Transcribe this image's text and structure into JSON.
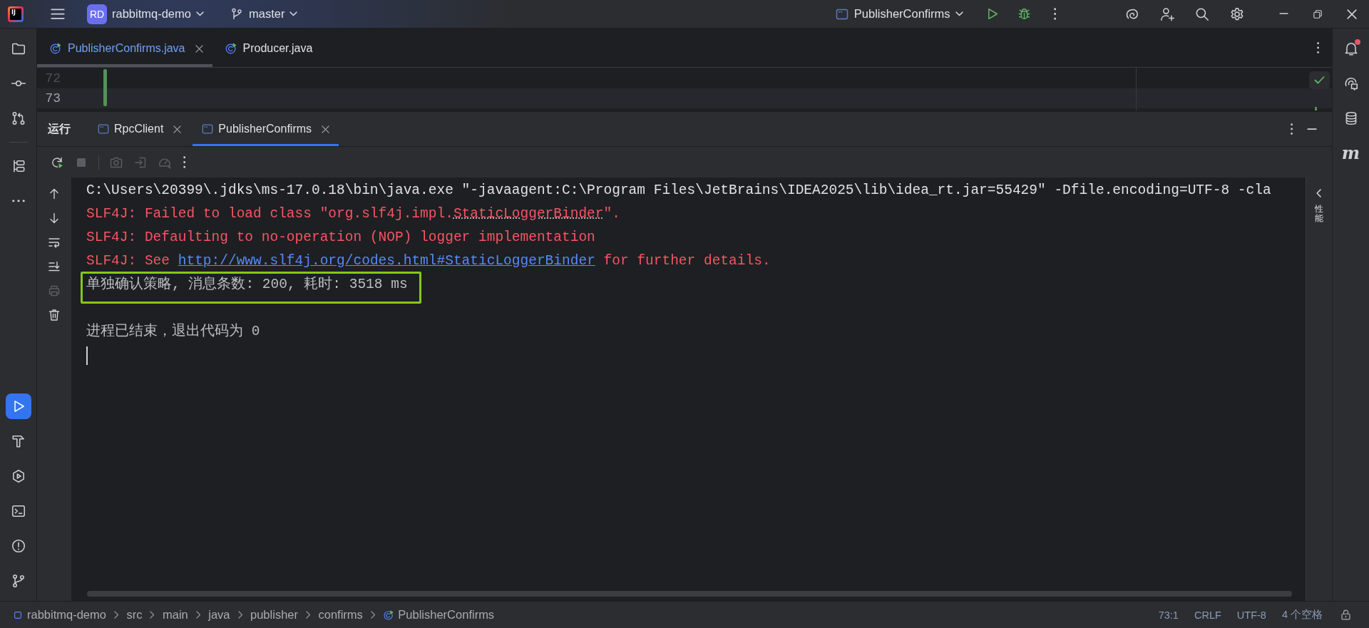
{
  "title_bar": {
    "logo": "IJ",
    "project": {
      "initials": "RD",
      "name": "rabbitmq-demo"
    },
    "branch": "master",
    "run_configuration": "PublisherConfirms"
  },
  "left_toolbar": {
    "top_groups": [
      [
        {
          "kind": "project",
          "selected": false
        },
        {
          "kind": "commit",
          "selected": false
        },
        {
          "kind": "pull_requests",
          "selected": false
        }
      ],
      [
        {
          "kind": "structure",
          "selected": false
        },
        {
          "kind": "more",
          "selected": false
        }
      ]
    ],
    "bottom": [
      {
        "kind": "run",
        "selected": true
      },
      {
        "kind": "build",
        "selected": false
      },
      {
        "kind": "services",
        "selected": false
      },
      {
        "kind": "terminal",
        "selected": false
      },
      {
        "kind": "problems",
        "selected": false
      },
      {
        "kind": "git",
        "selected": false
      }
    ]
  },
  "editor": {
    "tabs": [
      {
        "label": "PublisherConfirms.java",
        "modified": true,
        "selected": true,
        "closable": true
      },
      {
        "label": "Producer.java",
        "modified": false,
        "selected": false,
        "closable": false
      }
    ],
    "lines": [
      {
        "number": "72",
        "current": false
      },
      {
        "number": "73",
        "current": true
      }
    ]
  },
  "run_window": {
    "title": "运行",
    "tabs": [
      {
        "label": "RpcClient",
        "selected": false
      },
      {
        "label": "PublisherConfirms",
        "selected": true
      }
    ],
    "toolbar": [
      [
        {
          "kind": "rerun",
          "disabled": false
        },
        {
          "kind": "stop",
          "disabled": true
        }
      ],
      [
        {
          "kind": "screenshot",
          "disabled": true
        },
        {
          "kind": "attach",
          "disabled": true
        },
        {
          "kind": "profiler",
          "disabled": true
        },
        {
          "kind": "more",
          "disabled": false
        }
      ]
    ],
    "gutter": [
      {
        "kind": "up",
        "disabled": false
      },
      {
        "kind": "down",
        "disabled": false
      },
      {
        "kind": "soft_wrap",
        "disabled": false
      },
      {
        "kind": "scroll_to_end",
        "disabled": false
      },
      {
        "kind": "print",
        "disabled": true
      },
      {
        "kind": "clear",
        "disabled": false
      }
    ],
    "console": {
      "lines": [
        {
          "kind": "command",
          "highlighted": false,
          "segments": [
            {
              "kind": "text",
              "text": "C:\\Users\\20399\\.jdks\\ms-17.0.18\\bin\\java.exe \"-javaagent:C:\\Program Files\\JetBrains\\IDEA2025\\lib\\idea_rt.jar=55429\" -Dfile.encoding=UTF-8 -cla"
            }
          ]
        },
        {
          "kind": "error",
          "highlighted": false,
          "segments": [
            {
              "kind": "text",
              "text": "SLF4J: Failed to load class \"org.slf4j.impl."
            },
            {
              "kind": "typo",
              "text": "StaticLoggerBinder"
            },
            {
              "kind": "text",
              "text": "\"."
            }
          ]
        },
        {
          "kind": "error",
          "highlighted": false,
          "segments": [
            {
              "kind": "text",
              "text": "SLF4J: Defaulting to no-operation (NOP) logger implementation"
            }
          ]
        },
        {
          "kind": "error",
          "highlighted": false,
          "segments": [
            {
              "kind": "text",
              "text": "SLF4J: See "
            },
            {
              "kind": "link",
              "text": "http://www.slf4j.org/codes.html#StaticLoggerBinder"
            },
            {
              "kind": "text",
              "text": " for further details."
            }
          ]
        },
        {
          "kind": "output",
          "highlighted": true,
          "segments": [
            {
              "kind": "text",
              "text": "单独确认策略, 消息条数: 200, 耗时: 3518 ms"
            }
          ]
        },
        {
          "kind": "blank",
          "highlighted": false
        },
        {
          "kind": "output",
          "highlighted": false,
          "segments": [
            {
              "kind": "text",
              "text": "进程已结束，退出代码为 0"
            }
          ]
        },
        {
          "kind": "cursor",
          "highlighted": false
        }
      ],
      "side_panel": "性能"
    }
  },
  "right_toolbar": [
    {
      "kind": "notifications",
      "selected": false,
      "unread": true
    },
    {
      "kind": "ai_chat",
      "selected": false
    },
    {
      "kind": "database",
      "selected": false
    },
    {
      "kind": "maven",
      "glyph": "m",
      "selected": false
    }
  ],
  "status_bar": {
    "breadcrumbs": [
      {
        "kind": "module",
        "label": "rabbitmq-demo"
      },
      {
        "kind": "folder",
        "label": "src"
      },
      {
        "kind": "folder",
        "label": "main"
      },
      {
        "kind": "folder",
        "label": "java"
      },
      {
        "kind": "package",
        "label": "publisher"
      },
      {
        "kind": "package",
        "label": "confirms"
      },
      {
        "kind": "class",
        "label": "PublisherConfirms"
      }
    ],
    "position": "73:1",
    "line_separator": "CRLF",
    "encoding": "UTF-8",
    "indent": "4 个空格"
  }
}
